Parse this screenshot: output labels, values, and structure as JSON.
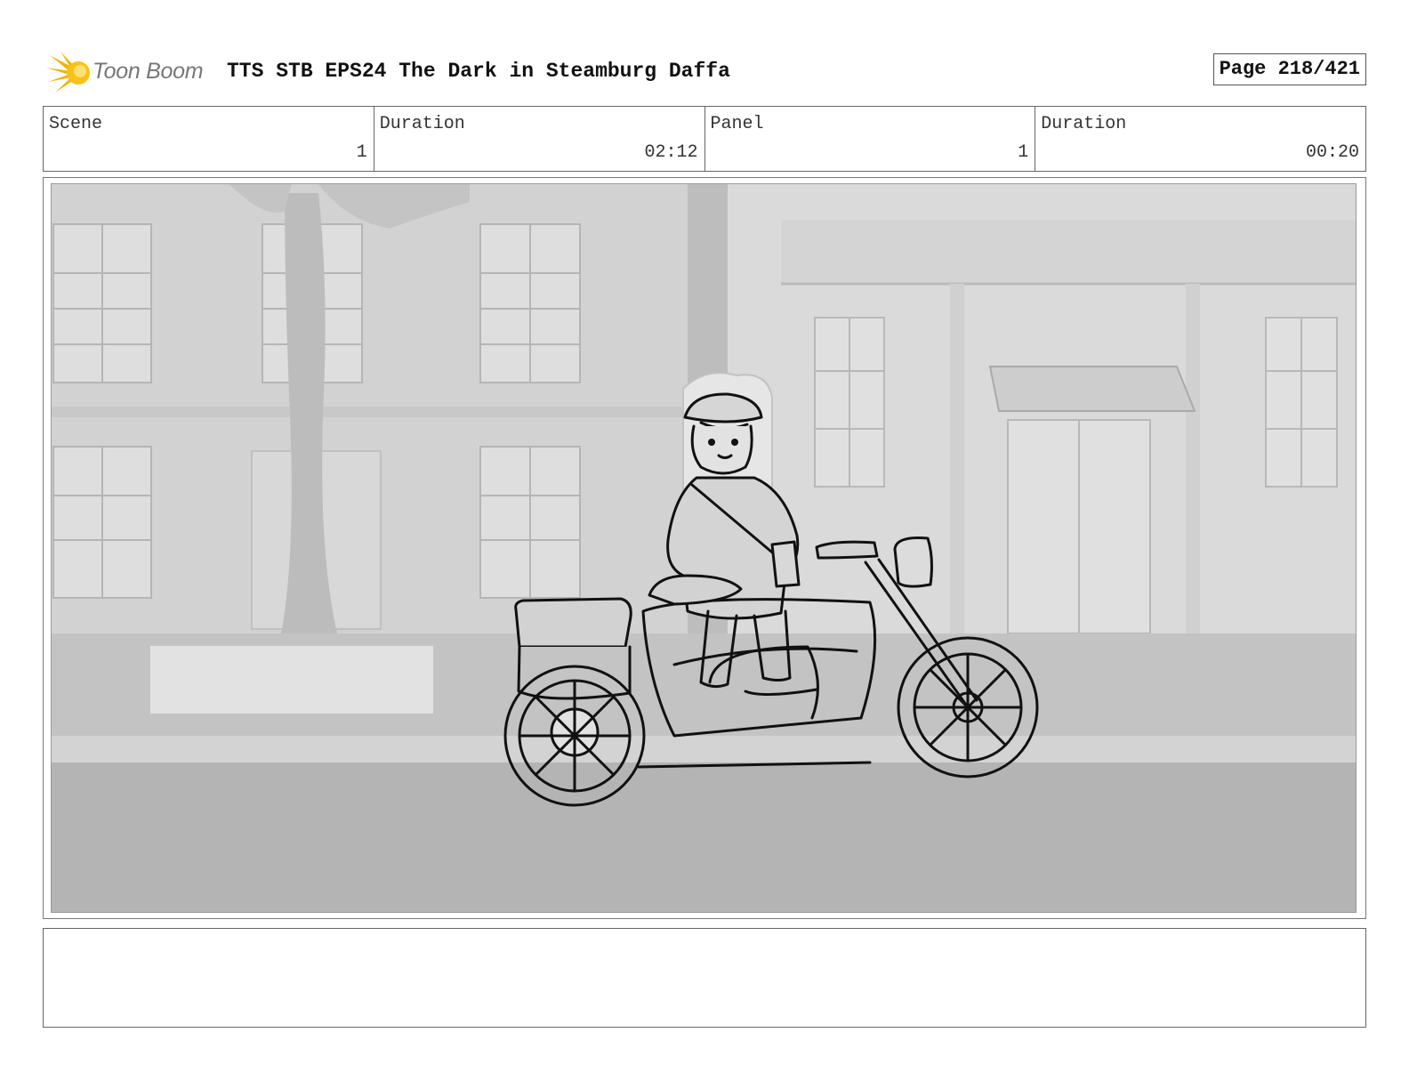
{
  "header": {
    "logo_text": "Toon Boom",
    "title": "TTS STB EPS24 The Dark in Steamburg Daffa",
    "page_label": "Page 218/421"
  },
  "info": {
    "scene_label": "Scene",
    "scene_value": "1",
    "scene_duration_label": "Duration",
    "scene_duration_value": "02:12",
    "panel_label": "Panel",
    "panel_value": "1",
    "panel_duration_label": "Duration",
    "panel_duration_value": "00:20"
  },
  "colors": {
    "logo_star": "#f5b400",
    "background_gray": "#d6d6d6",
    "sketch_line": "#111111"
  },
  "notes": {
    "text": ""
  }
}
